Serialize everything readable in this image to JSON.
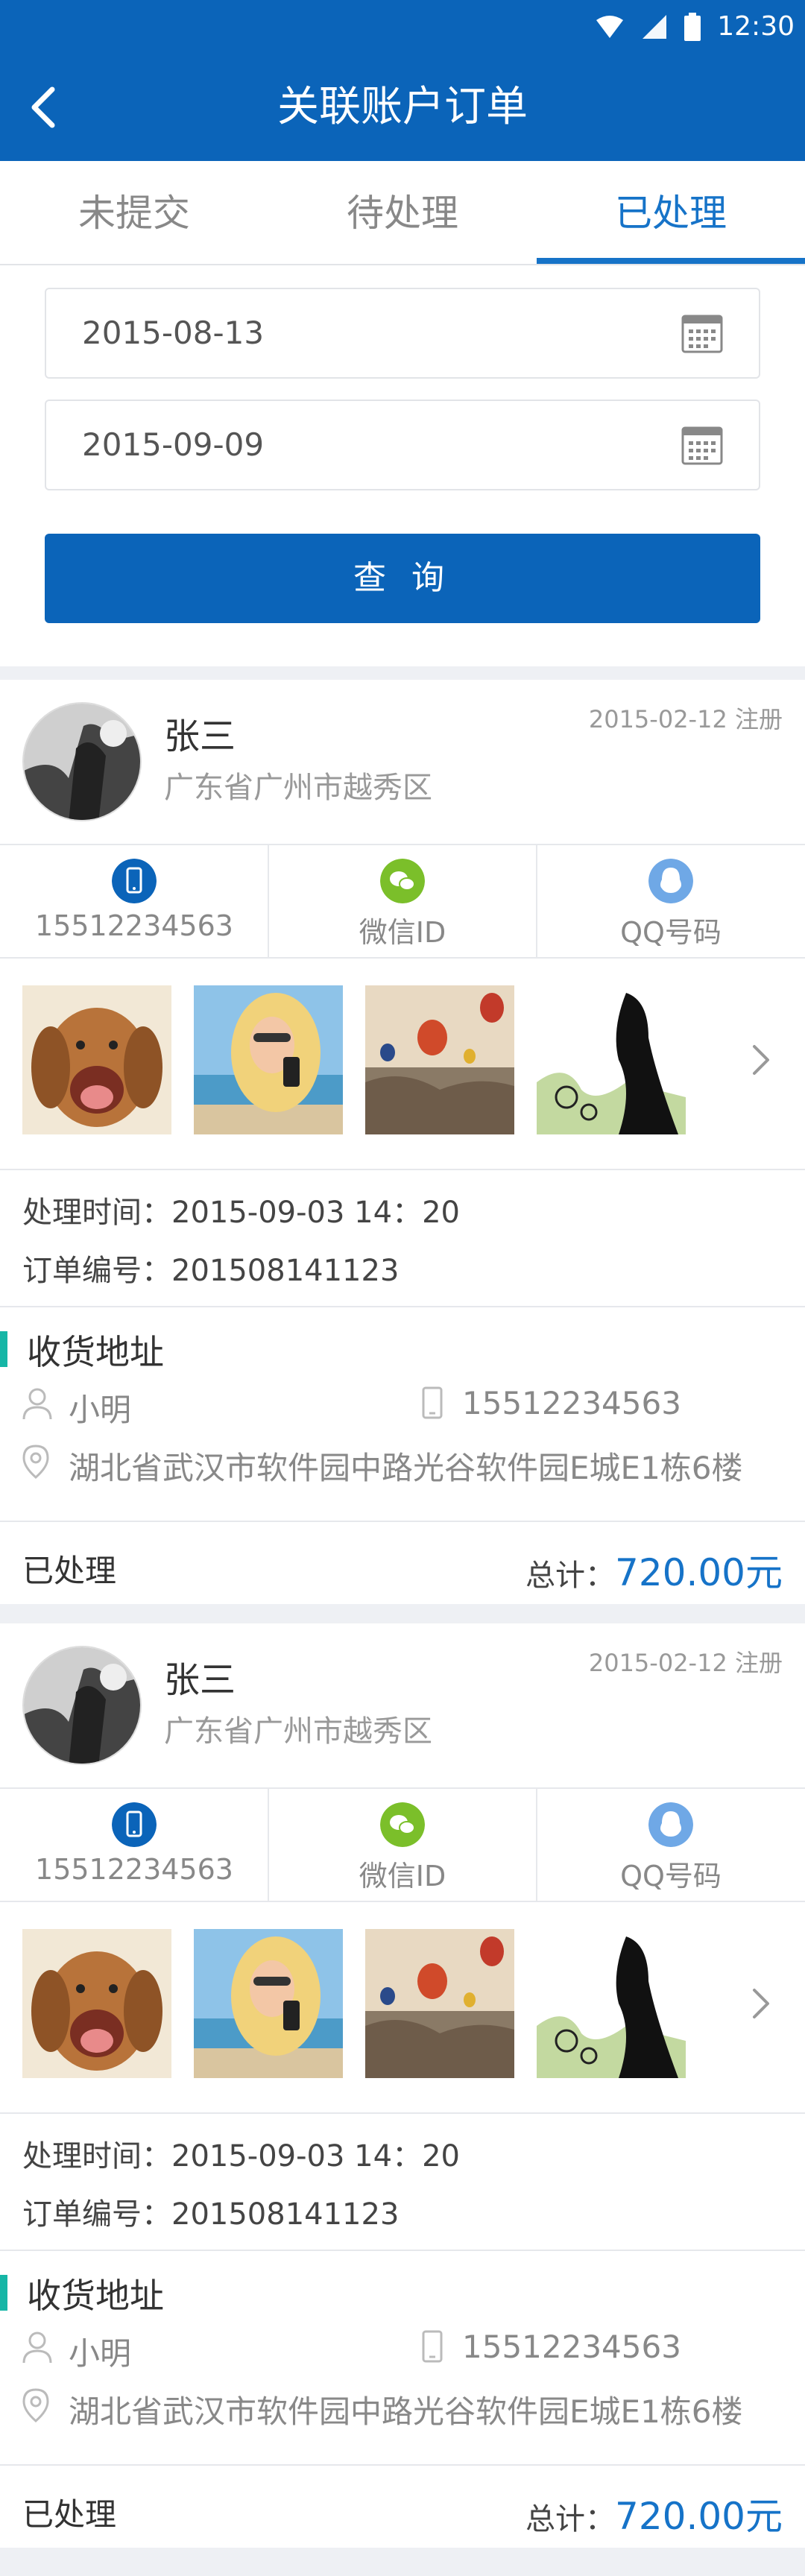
{
  "status_bar": {
    "time": "12:30"
  },
  "header": {
    "title": "关联账户订单"
  },
  "tabs": [
    {
      "label": "未提交"
    },
    {
      "label": "待处理"
    },
    {
      "label": "已处理"
    }
  ],
  "filter": {
    "start_date": "2015-08-13",
    "end_date": "2015-09-09",
    "query_label": "查 询"
  },
  "orders": [
    {
      "name": "张三",
      "location": "广东省广州市越秀区",
      "register_text": "2015-02-12 注册",
      "phone": "15512234563",
      "wechat_label": "微信ID",
      "qq_label": "QQ号码",
      "process_time": "处理时间：2015-09-03  14：20",
      "order_no": "订单编号：201508141123",
      "address_title": "收货地址",
      "receiver": "小明",
      "receiver_phone": "15512234563",
      "address": "湖北省武汉市软件园中路光谷软件园E城E1栋6楼",
      "status": "已处理",
      "total_label": "总计：",
      "total_amount": "720.00元"
    },
    {
      "name": "张三",
      "location": "广东省广州市越秀区",
      "register_text": "2015-02-12 注册",
      "phone": "15512234563",
      "wechat_label": "微信ID",
      "qq_label": "QQ号码",
      "process_time": "处理时间：2015-09-03  14：20",
      "order_no": "订单编号：201508141123",
      "address_title": "收货地址",
      "receiver": "小明",
      "receiver_phone": "15512234563",
      "address": "湖北省武汉市软件园中路光谷软件园E城E1栋6楼",
      "status": "已处理",
      "total_label": "总计：",
      "total_amount": "720.00元"
    }
  ],
  "colors": {
    "brand": "#0b64b9",
    "accent": "#1673c8",
    "wechat": "#7bbf2a",
    "qq": "#6fa8e6",
    "section_bar": "#16b6a6"
  }
}
